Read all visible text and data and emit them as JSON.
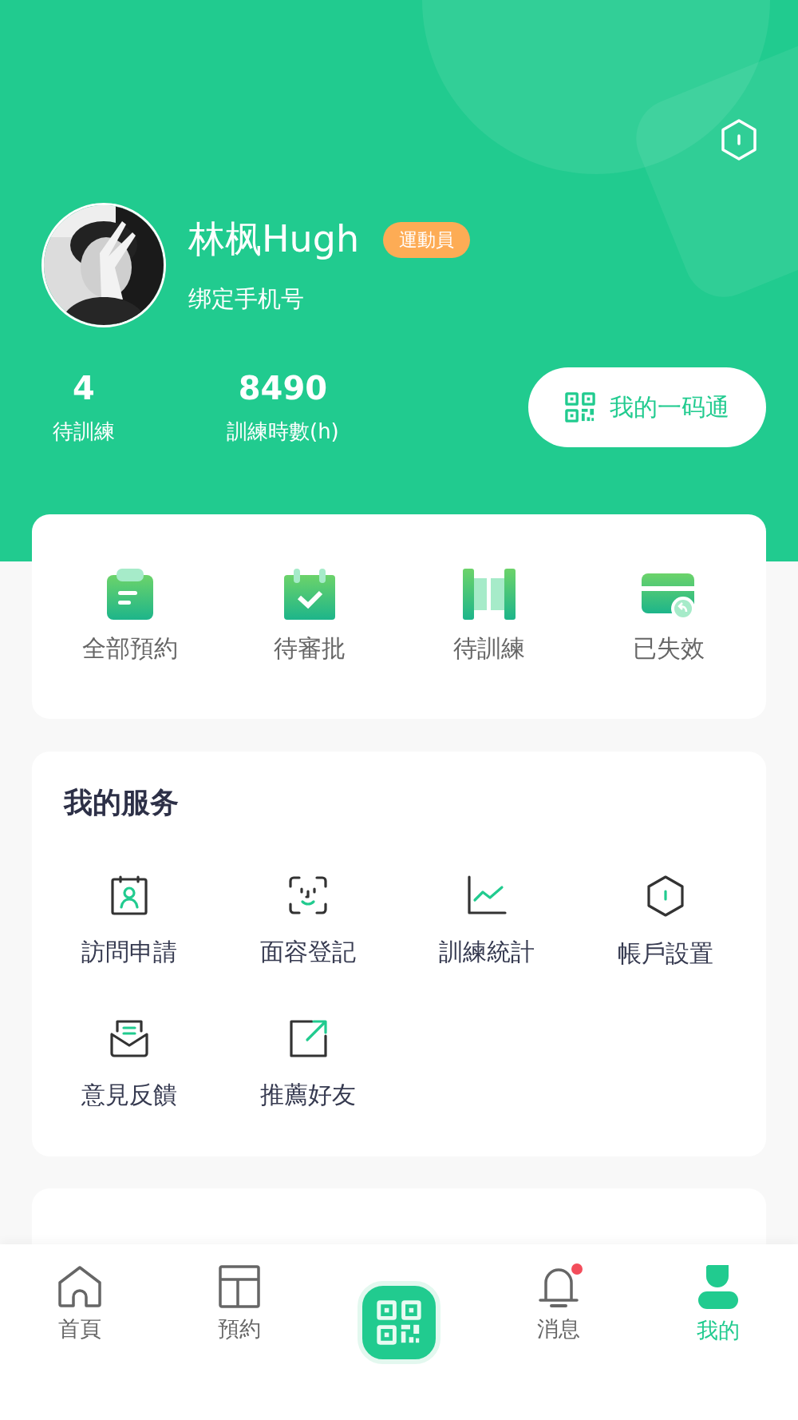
{
  "profile": {
    "name": "林枫Hugh",
    "role_badge": "運動員",
    "phone_link": "绑定手机号"
  },
  "stats": [
    {
      "value": "4",
      "label": "待訓練"
    },
    {
      "value": "8490",
      "label": "訓練時數(h)"
    }
  ],
  "pass_button": {
    "label": "我的一码通"
  },
  "booking_shortcuts": [
    {
      "label": "全部預約"
    },
    {
      "label": "待審批"
    },
    {
      "label": "待訓練"
    },
    {
      "label": "已失效"
    }
  ],
  "services": {
    "title": "我的服务",
    "items": [
      {
        "label": "訪問申請"
      },
      {
        "label": "面容登記"
      },
      {
        "label": "訓練統計"
      },
      {
        "label": "帳戶設置"
      },
      {
        "label": "意見反饋"
      },
      {
        "label": "推薦好友"
      }
    ]
  },
  "tab_bar": [
    {
      "kind": "tab",
      "label": "首頁",
      "selected": false
    },
    {
      "kind": "tab",
      "label": "預約",
      "selected": false
    },
    {
      "kind": "scan"
    },
    {
      "kind": "tab",
      "label": "消息",
      "selected": false,
      "notification": true
    },
    {
      "kind": "tab",
      "label": "我的",
      "selected": true
    }
  ]
}
